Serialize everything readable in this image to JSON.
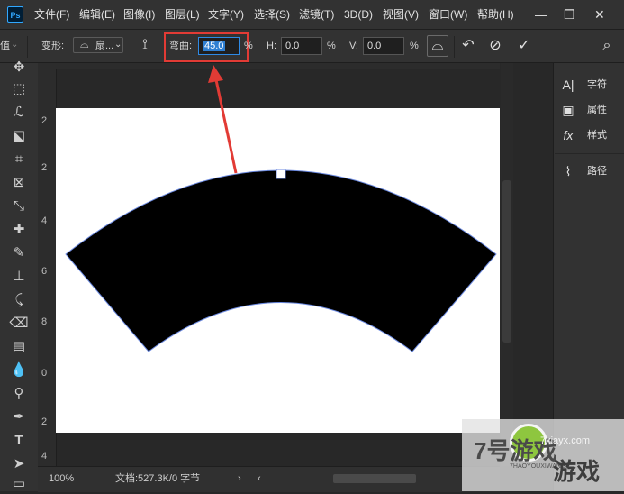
{
  "app": {
    "logo": "Ps"
  },
  "menu": [
    "文件(F)",
    "编辑(E)",
    "图像(I)",
    "图层(L)",
    "文字(Y)",
    "选择(S)",
    "滤镜(T)",
    "3D(D)",
    "视图(V)",
    "窗口(W)",
    "帮助(H)"
  ],
  "window_controls": {
    "minimize": "—",
    "restore": "❐",
    "close": "✕"
  },
  "options": {
    "left_fragment": "值",
    "warp_label": "变形:",
    "warp_style": "扇...",
    "bend_label": "弯曲:",
    "bend_value": "45.0",
    "bend_unit": "%",
    "h_label": "H:",
    "h_value": "0.0",
    "h_unit": "%",
    "v_label": "V:",
    "v_value": "0.0",
    "v_unit": "%"
  },
  "rulers": {
    "left_numbers": [
      "2",
      "2",
      "4",
      "6",
      "8",
      "0",
      "2",
      "4"
    ]
  },
  "panels": [
    {
      "icon": "A|",
      "label": "字符"
    },
    {
      "icon": "▣",
      "label": "属性"
    },
    {
      "icon": "fx",
      "label": "样式"
    },
    {
      "icon": "⌇",
      "label": "路径"
    }
  ],
  "status": {
    "zoom": "100%",
    "doc_info": "文档:527.3K/0 字节",
    "arrow": "›",
    "scroll_left": "‹"
  },
  "watermark": {
    "brand": "7号游戏",
    "site": "7xiayx.com",
    "sub": "7HAOYOUXIWANG",
    "game": "游戏"
  },
  "colors": {
    "highlight": "#e23b35",
    "selection": "#2f7fd1",
    "shape_fill": "#000000",
    "path_stroke": "#6c8ae0"
  }
}
